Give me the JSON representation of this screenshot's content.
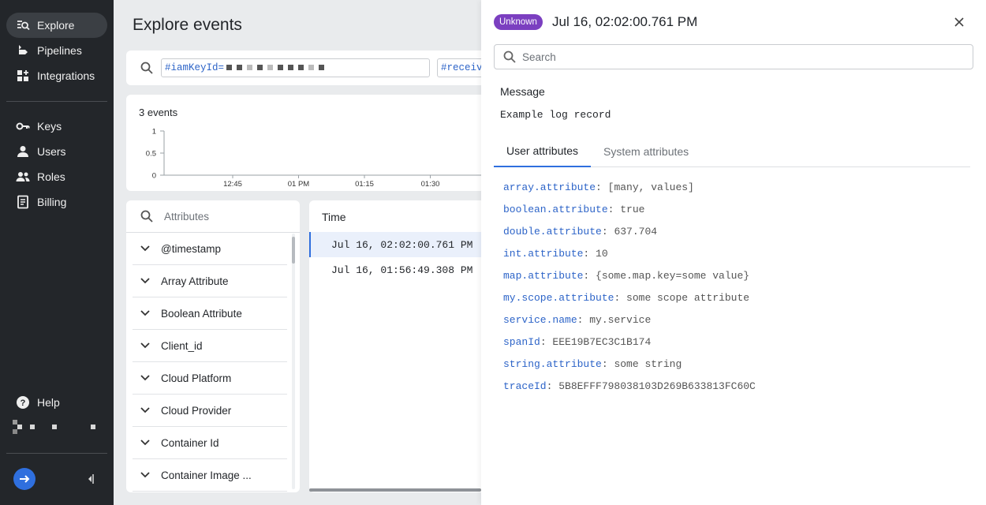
{
  "sidebar": {
    "items": [
      {
        "label": "Explore",
        "icon": "explore-icon"
      },
      {
        "label": "Pipelines",
        "icon": "pipelines-icon"
      },
      {
        "label": "Integrations",
        "icon": "integrations-icon"
      },
      {
        "label": "Keys",
        "icon": "key-icon"
      },
      {
        "label": "Users",
        "icon": "user-icon"
      },
      {
        "label": "Roles",
        "icon": "roles-icon"
      },
      {
        "label": "Billing",
        "icon": "billing-icon"
      }
    ],
    "help_label": "Help",
    "accent": "#2f6fde"
  },
  "main": {
    "title": "Explore events",
    "query_chip_1": "#iamKeyId=",
    "query_chip_2": "#receiv",
    "chart": {
      "count_label": "3 events"
    },
    "attributes": {
      "search_placeholder": "Attributes",
      "items": [
        "@timestamp",
        "Array Attribute",
        "Boolean Attribute",
        "Client_id",
        "Cloud Platform",
        "Cloud Provider",
        "Container Id",
        "Container Image ..."
      ]
    },
    "results": {
      "column_time": "Time",
      "rows": [
        "Jul 16, 02:02:00.761 PM",
        "Jul 16, 01:56:49.308 PM"
      ]
    }
  },
  "chart_data": {
    "type": "bar",
    "title": "",
    "xlabel": "",
    "ylabel": "",
    "y_ticks": [
      "1",
      "0.5",
      "0"
    ],
    "x_ticks": [
      "12:45",
      "01 PM",
      "01:15",
      "01:30"
    ],
    "ylim": [
      0,
      1
    ],
    "categories": [],
    "values": []
  },
  "panel": {
    "badge": "Unknown",
    "badge_color": "#7b3fc0",
    "title": "Jul 16, 02:02:00.761 PM",
    "search_placeholder": "Search",
    "message_label": "Message",
    "message_value": "Example log record",
    "tabs": [
      "User attributes",
      "System attributes"
    ],
    "attributes": [
      {
        "key": "array.attribute",
        "value": "[many, values]"
      },
      {
        "key": "boolean.attribute",
        "value": "true"
      },
      {
        "key": "double.attribute",
        "value": "637.704"
      },
      {
        "key": "int.attribute",
        "value": "10"
      },
      {
        "key": "map.attribute",
        "value": "{some.map.key=some value}"
      },
      {
        "key": "my.scope.attribute",
        "value": "some scope attribute"
      },
      {
        "key": "service.name",
        "value": "my.service"
      },
      {
        "key": "spanId",
        "value": "EEE19B7EC3C1B174"
      },
      {
        "key": "string.attribute",
        "value": "some string"
      },
      {
        "key": "traceId",
        "value": "5B8EFFF798038103D269B633813FC60C"
      }
    ]
  }
}
